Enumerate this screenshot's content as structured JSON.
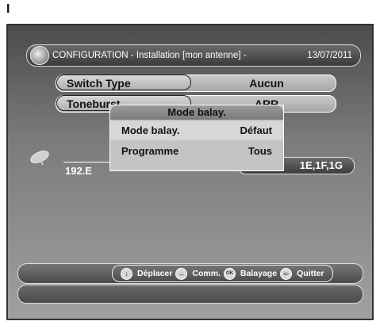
{
  "page_marker": "I",
  "header": {
    "title": "CONFIGURATION - Installation [mon antenne] -",
    "date": "13/07/2011"
  },
  "rows": [
    {
      "label": "Switch Type",
      "value": "Aucun"
    },
    {
      "label": "Toneburst",
      "value": "ARR"
    }
  ],
  "popup": {
    "title": "Mode balay.",
    "items": [
      {
        "label": "Mode balay.",
        "value": "Défaut"
      },
      {
        "label": "Programme",
        "value": "Tous"
      }
    ]
  },
  "satellite": {
    "position": "192.E",
    "diseqc_value": "1E,1F,1G"
  },
  "footer": {
    "move": "Déplacer",
    "command": "Comm.",
    "ok_icon": "OK",
    "scan": "Balayage",
    "quit": "Quitter"
  },
  "colors": {
    "screen_top": "#4b4b4b",
    "screen_bottom": "#a0a0a0",
    "popup_bg": "#c4c4c4"
  },
  "icons": [
    "logo-icon",
    "satellite-dish-icon",
    "up-down-icon",
    "left-right-icon",
    "ok-icon",
    "exit-icon"
  ]
}
